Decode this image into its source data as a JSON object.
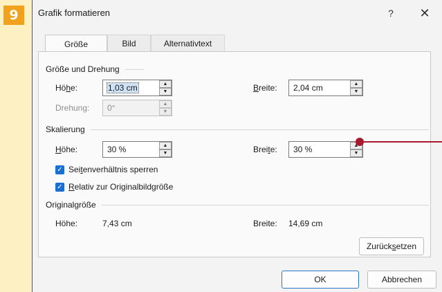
{
  "step": "9",
  "window": {
    "title": "Grafik formatieren",
    "help_label": "?",
    "close_label": "✕"
  },
  "tabs": [
    {
      "label": "Größe",
      "active": true
    },
    {
      "label": "Bild",
      "active": false
    },
    {
      "label": "Alternativtext",
      "active": false
    }
  ],
  "size_rotation": {
    "heading": "Größe und Drehung",
    "height_label_pre": "Hö",
    "height_label_key": "h",
    "height_label_post": "e:",
    "height_value": "1,03 cm",
    "width_label_key": "B",
    "width_label_post": "reite:",
    "width_value": "2,04 cm",
    "rotation_label": "Drehung:",
    "rotation_value": "0°"
  },
  "scaling": {
    "heading": "Skalierung",
    "height_label_key": "H",
    "height_label_post": "öhe:",
    "height_value": "30 %",
    "width_label_pre": "Brei",
    "width_label_key": "t",
    "width_label_post": "e:",
    "width_value": "30 %",
    "lock_pre": "Sei",
    "lock_key": "t",
    "lock_post": "enverhältnis sperren",
    "relative_key": "R",
    "relative_post": "elativ zur Originalbildgröße"
  },
  "original": {
    "heading": "Originalgröße",
    "height_label": "Höhe:",
    "height_value": "7,43 cm",
    "width_label": "Breite:",
    "width_value": "14,69 cm"
  },
  "buttons": {
    "reset_pre": "Zurück",
    "reset_key": "s",
    "reset_post": "etzen",
    "ok": "OK",
    "cancel": "Abbrechen"
  },
  "icons": {
    "up": "▲",
    "down": "▼",
    "check": "✓"
  },
  "colors": {
    "accent": "#1a6fd1",
    "badge": "#f0a21e",
    "marker": "#a8192e"
  }
}
